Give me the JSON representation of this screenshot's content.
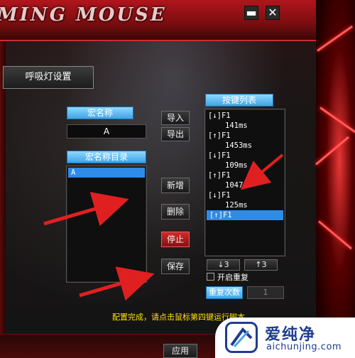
{
  "window": {
    "brand_text": "MING MOUSE",
    "minimize_symbol": "▬",
    "close_symbol": "✕"
  },
  "sidebar": {
    "breath_light_label": "呼吸灯设置"
  },
  "macro": {
    "name_header": "宏名称",
    "name_value": "A",
    "dir_header": "宏名称目录",
    "dir_items": [
      {
        "label": "A",
        "selected": true
      }
    ]
  },
  "actions": {
    "import": "导入",
    "export": "导出",
    "add": "新增",
    "delete": "删除",
    "stop": "停止",
    "save": "保存",
    "apply": "应用"
  },
  "key_list": {
    "header": "按键列表",
    "rows": [
      {
        "text": "[↓]F1",
        "kind": "key",
        "selected": false
      },
      {
        "text": "141ms",
        "kind": "delay",
        "selected": false
      },
      {
        "text": "[↑]F1",
        "kind": "key",
        "selected": false
      },
      {
        "text": "1453ms",
        "kind": "delay",
        "selected": false
      },
      {
        "text": "[↓]F1",
        "kind": "key",
        "selected": false
      },
      {
        "text": "109ms",
        "kind": "delay",
        "selected": false
      },
      {
        "text": "[↑]F1",
        "kind": "key",
        "selected": false
      },
      {
        "text": "1047ms",
        "kind": "delay",
        "selected": false
      },
      {
        "text": "[↓]F1",
        "kind": "key",
        "selected": false
      },
      {
        "text": "125ms",
        "kind": "delay",
        "selected": false
      },
      {
        "text": "[↑]F1",
        "kind": "key",
        "selected": true
      }
    ],
    "down_count": "↓3",
    "up_count": "↑3",
    "loop_label": "开启重复",
    "repeat_label": "重复次数",
    "repeat_value": "1"
  },
  "status": {
    "text": "配置完成，请点击鼠标第四键运行脚本"
  },
  "watermark": {
    "main": "爱纯净",
    "sub": "aichunjing.com"
  },
  "colors": {
    "accent_blue": "#3ea4e6",
    "status_yellow": "#ffe100",
    "stop_red": "#d02a2a",
    "arrow_red": "#e02020"
  }
}
